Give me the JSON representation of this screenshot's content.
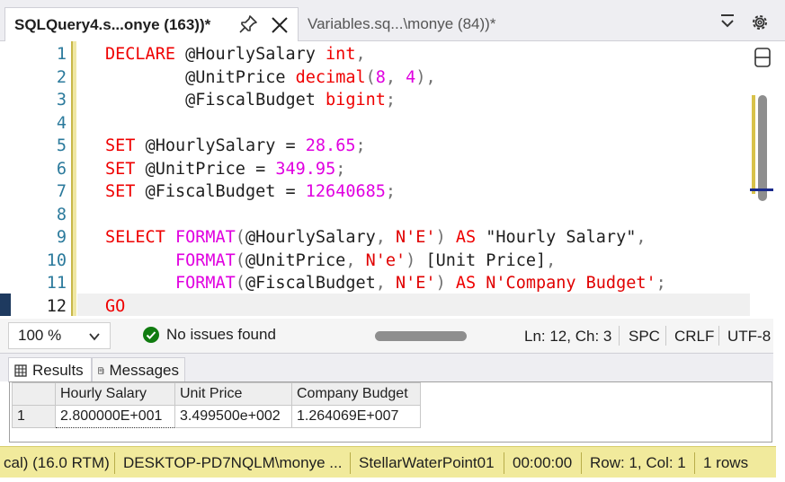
{
  "tabs": [
    {
      "title": "SQLQuery4.s...onye (163))*",
      "active": true
    },
    {
      "title": "Variables.sq...\\monye (84))*",
      "active": false
    }
  ],
  "editor": {
    "line_numbers": [
      "1",
      "2",
      "3",
      "4",
      "5",
      "6",
      "7",
      "8",
      "9",
      "10",
      "11",
      "12"
    ],
    "current_line": "12"
  },
  "status": {
    "zoom": "100 %",
    "issues": "No issues found",
    "position": "Ln: 12, Ch: 3",
    "whitespace": "SPC",
    "line_ending": "CRLF",
    "encoding": "UTF-8"
  },
  "results": {
    "tab_results": "Results",
    "tab_messages": "Messages",
    "columns": [
      "Hourly Salary",
      "Unit Price",
      "Company Budget"
    ],
    "rows": [
      {
        "num": "1",
        "cells": [
          "2.800000E+001",
          "3.499500e+002",
          "1.264069E+007"
        ]
      }
    ]
  },
  "bottom_bar": {
    "server": "cal) (16.0 RTM)",
    "user": "DESKTOP-PD7NQLM\\monye ...",
    "database": "StellarWaterPoint01",
    "elapsed": "00:00:00",
    "rowcol": "Row: 1, Col: 1",
    "rows": "1 rows"
  },
  "colors": {
    "keyword": "#ef0000",
    "number": "#e000e0",
    "string": "#e00000",
    "linenum": "#2b7a9c",
    "statusbar": "#f1ea9c",
    "ok_green": "#107c10"
  }
}
